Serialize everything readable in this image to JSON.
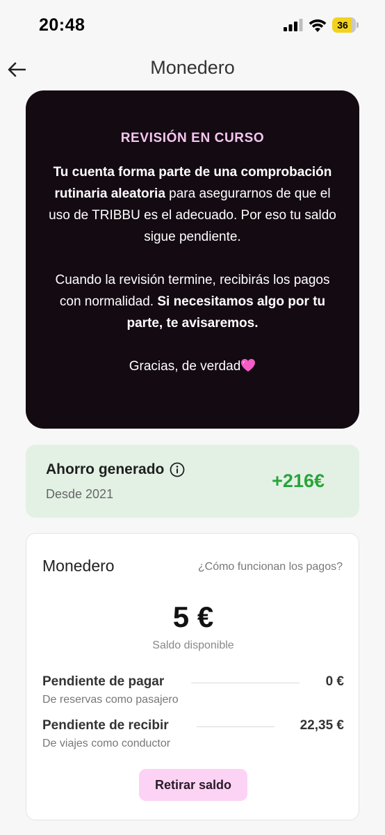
{
  "status_bar": {
    "time": "20:48",
    "battery": "36"
  },
  "header": {
    "title": "Monedero"
  },
  "review": {
    "title": "REVISIÓN EN CURSO",
    "p1_bold": "Tu cuenta forma parte de una comprobación rutinaria aleatoria",
    "p1_rest": " para asegurarnos de que el uso de TRIBBU es el adecuado. Por eso tu saldo sigue pendiente.",
    "p2_start": "Cuando la revisión termine, recibirás los pagos con normalidad. ",
    "p2_bold": "Si necesitamos algo por tu parte, te avisaremos.",
    "p3": "Gracias, de verdad"
  },
  "savings": {
    "label": "Ahorro generado",
    "since": "Desde 2021",
    "amount": "+216€"
  },
  "wallet": {
    "title": "Monedero",
    "help_link": "¿Cómo funcionan los pagos?",
    "balance": "5 €",
    "balance_label": "Saldo disponible",
    "rows": [
      {
        "label": "Pendiente de pagar",
        "sub": "De reservas como pasajero",
        "value": "0 €"
      },
      {
        "label": "Pendiente de recibir",
        "sub": "De viajes como conductor",
        "value": "22,35 €"
      }
    ],
    "withdraw_label": "Retirar saldo"
  },
  "colors": {
    "review_bg": "#140a12",
    "review_title": "#f6c6f0",
    "savings_bg": "#e3f1e5",
    "savings_amount": "#2aa43a",
    "withdraw_bg": "#fcd3f4"
  }
}
